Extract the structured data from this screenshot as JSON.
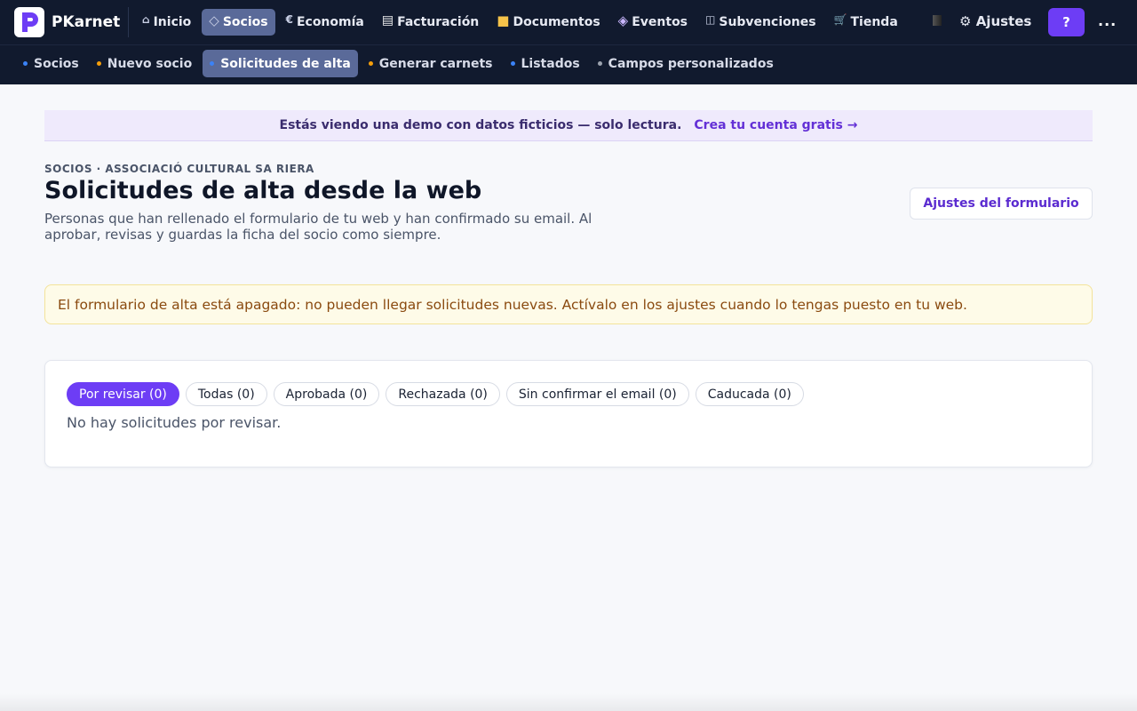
{
  "app": {
    "name": "PKarnet",
    "logo_icon": "p-logo-icon",
    "brand_color": "#6d3df5"
  },
  "topnav": {
    "items": [
      {
        "label": "Inicio",
        "icon": "home-icon"
      },
      {
        "label": "Socios",
        "icon": "diamond-icon",
        "active": true
      },
      {
        "label": "Economía",
        "icon": "euro-icon"
      },
      {
        "label": "Facturación",
        "icon": "invoice-icon"
      },
      {
        "label": "Documentos",
        "icon": "folder-icon"
      },
      {
        "label": "Eventos",
        "icon": "event-diamond-icon"
      },
      {
        "label": "Subvenciones",
        "icon": "book-icon"
      },
      {
        "label": "Tienda",
        "icon": "cart-icon"
      }
    ],
    "settings_label": "Ajustes",
    "help_label": "?",
    "more_label": "..."
  },
  "subnav": {
    "items": [
      {
        "label": "Socios",
        "dot_color": "#3b82f6"
      },
      {
        "label": "Nuevo socio",
        "dot_color": "#f59e0b"
      },
      {
        "label": "Solicitudes de alta",
        "dot_color": "#3b82f6",
        "active": true
      },
      {
        "label": "Generar carnets",
        "dot_color": "#f59e0b"
      },
      {
        "label": "Listados",
        "dot_color": "#3b82f6"
      },
      {
        "label": "Campos personalizados",
        "dot_color": "#9ca3af"
      }
    ]
  },
  "banner": {
    "text": "Estás viendo una demo con datos ficticios — solo lectura.",
    "link": "Crea tu cuenta gratis →"
  },
  "page": {
    "breadcrumb": "SOCIOS · ASSOCIACIÓ CULTURAL SA RIERA",
    "title": "Solicitudes de alta desde la web",
    "description": "Personas que han rellenado el formulario de tu web y han confirmado su email. Al aprobar, revisas y guardas la ficha del socio como siempre.",
    "form_settings_label": "Ajustes del formulario"
  },
  "warning": {
    "text": "El formulario de alta está apagado: no pueden llegar solicitudes nuevas. Actívalo en los ajustes cuando lo tengas puesto en tu web."
  },
  "requests": {
    "filters": [
      {
        "label": "Por revisar (0)",
        "active": true
      },
      {
        "label": "Todas (0)"
      },
      {
        "label": "Aprobada (0)"
      },
      {
        "label": "Rechazada (0)"
      },
      {
        "label": "Sin confirmar el email (0)"
      },
      {
        "label": "Caducada (0)"
      }
    ],
    "empty_message": "No hay solicitudes por revisar."
  }
}
